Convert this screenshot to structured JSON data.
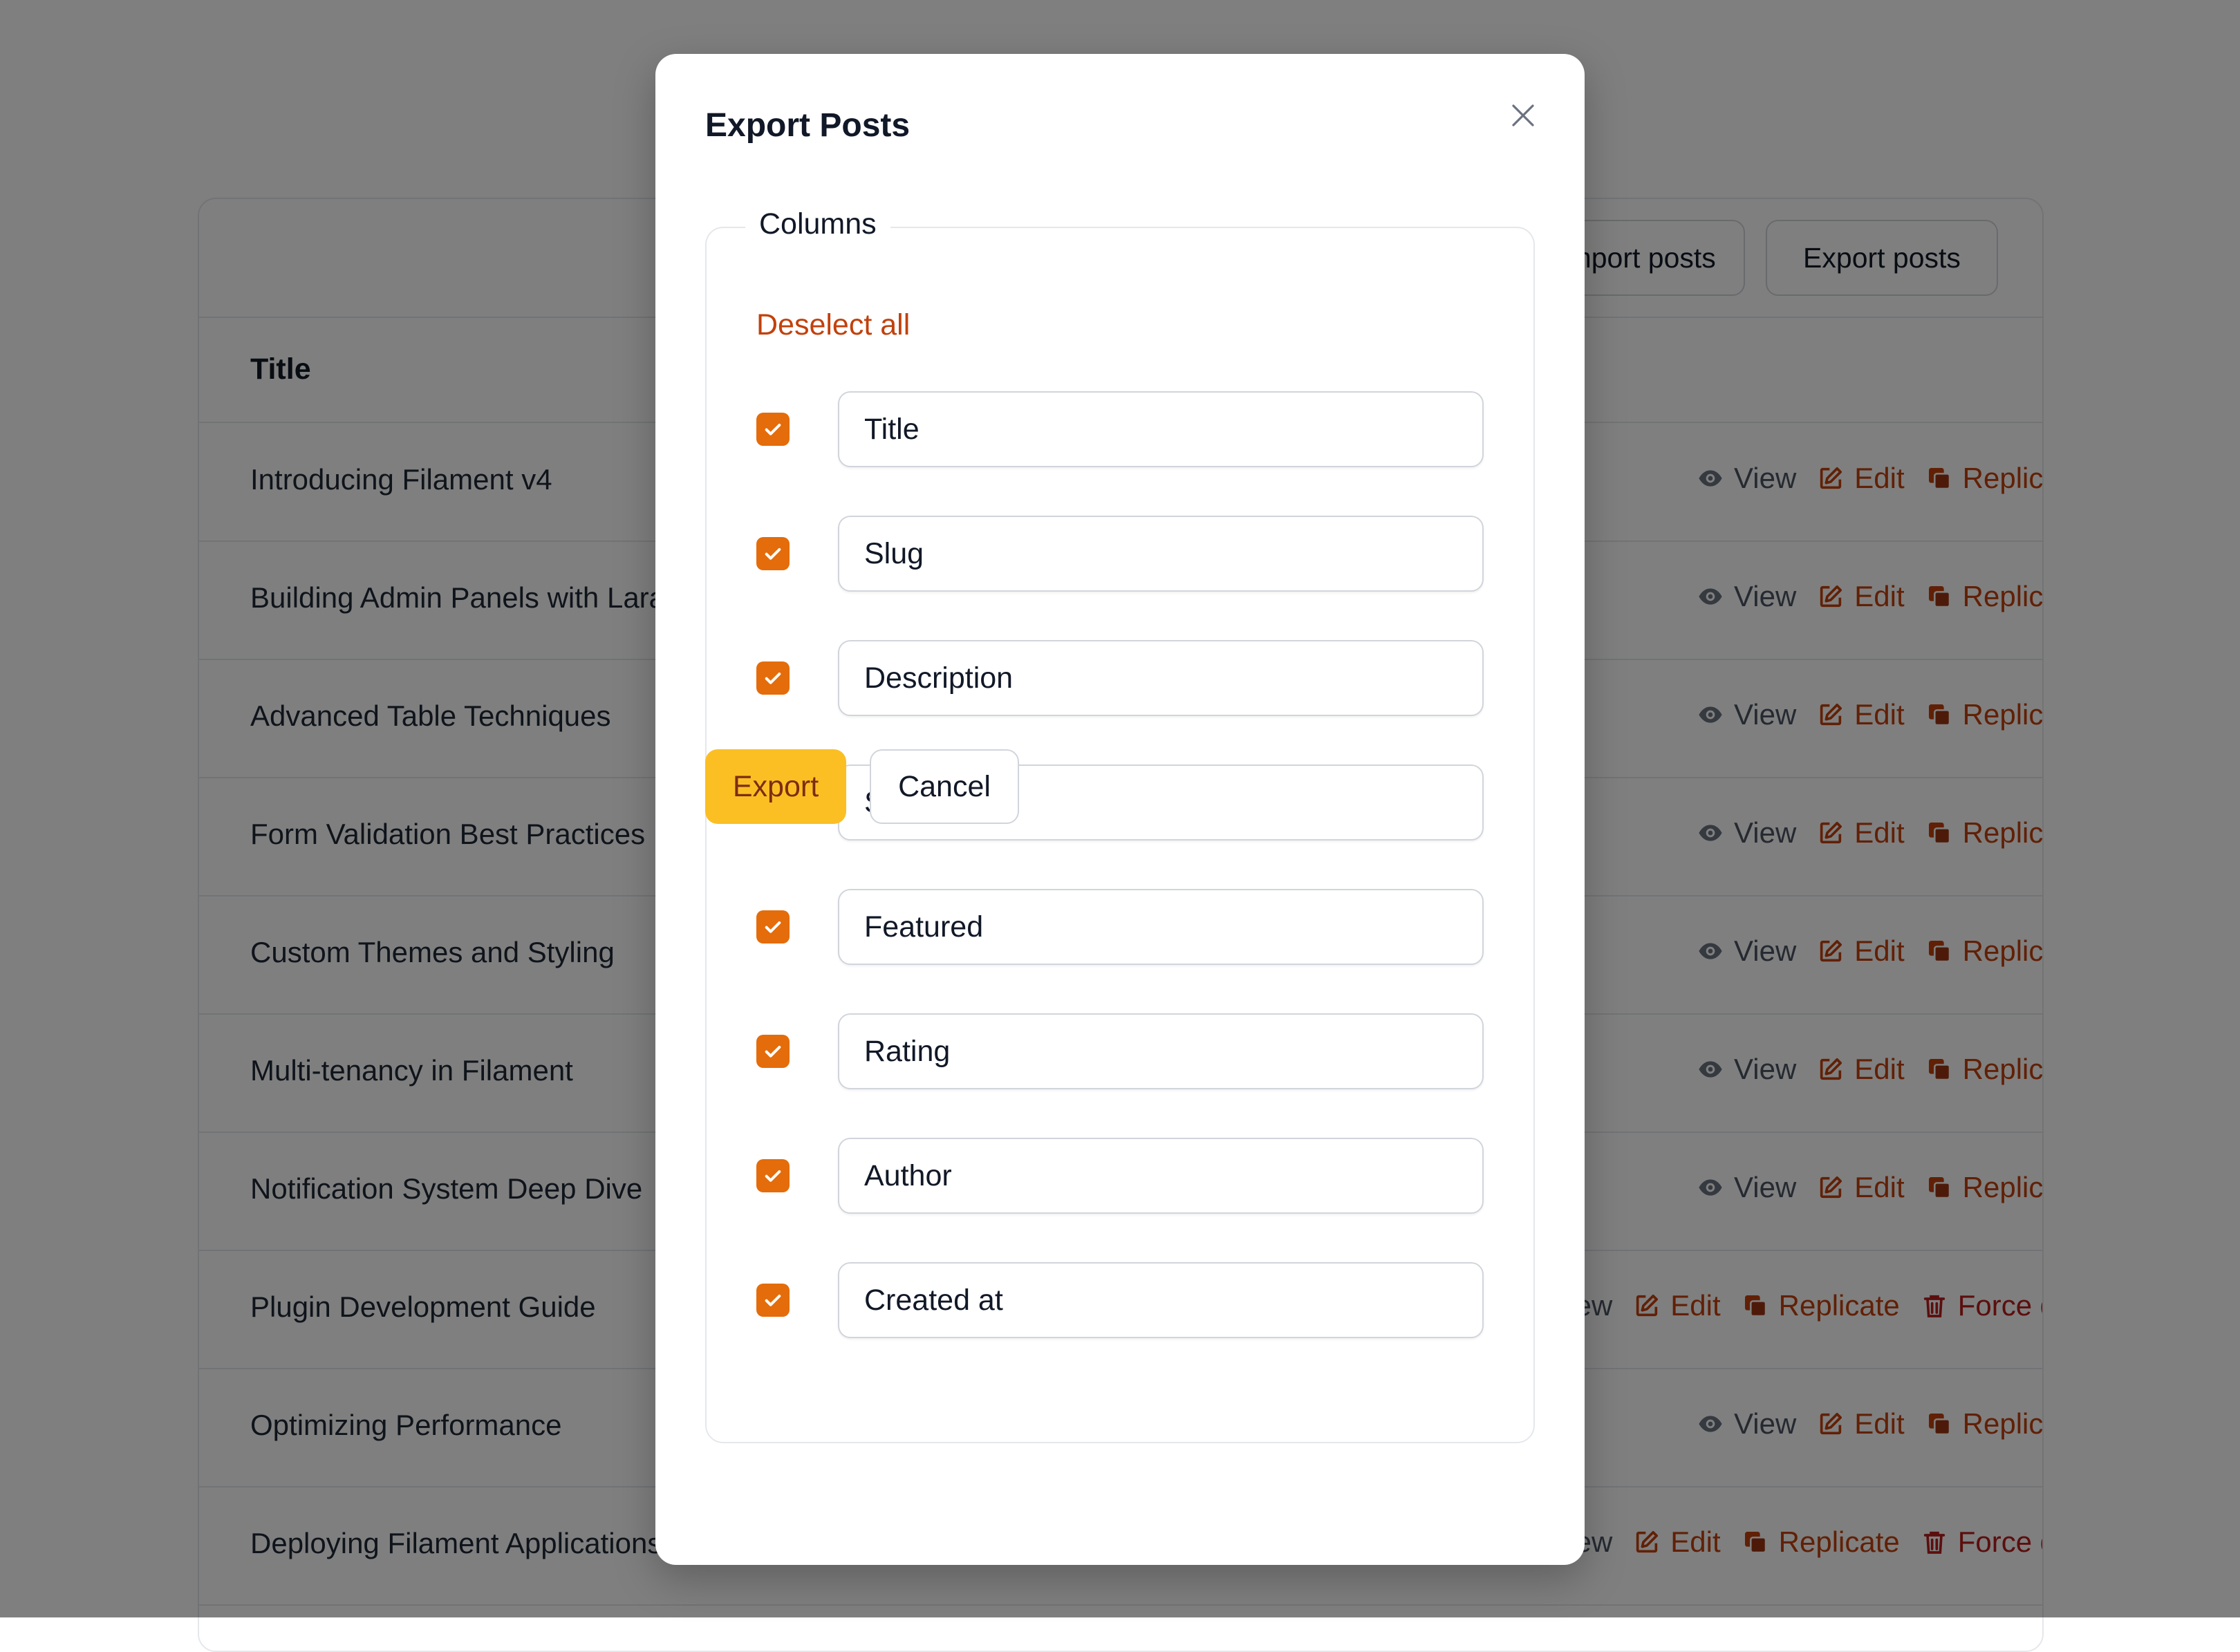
{
  "toolbar": {
    "import_label": "Import posts",
    "export_label": "Export posts"
  },
  "table": {
    "header_title": "Title",
    "rows": [
      {
        "title": "Introducing Filament v4",
        "variant": "a"
      },
      {
        "title": "Building Admin Panels with Laravel",
        "variant": "a"
      },
      {
        "title": "Advanced Table Techniques",
        "variant": "a"
      },
      {
        "title": "Form Validation Best Practices",
        "variant": "a"
      },
      {
        "title": "Custom Themes and Styling",
        "variant": "a"
      },
      {
        "title": "Multi-tenancy in Filament",
        "variant": "a"
      },
      {
        "title": "Notification System Deep Dive",
        "variant": "a"
      },
      {
        "title": "Plugin Development Guide",
        "variant": "b"
      },
      {
        "title": "Optimizing Performance",
        "variant": "a"
      },
      {
        "title": "Deploying Filament Applications",
        "variant": "b"
      }
    ],
    "actions": {
      "view": "View",
      "edit": "Edit",
      "replicate": "Replicate",
      "force_delete": "Force delete"
    }
  },
  "modal": {
    "title": "Export Posts",
    "close_icon": "x-mark-icon",
    "columns_legend": "Columns",
    "deselect_all": "Deselect all",
    "columns": [
      {
        "label": "Title",
        "checked": true
      },
      {
        "label": "Slug",
        "checked": true
      },
      {
        "label": "Description",
        "checked": true
      },
      {
        "label": "Status",
        "checked": true
      },
      {
        "label": "Featured",
        "checked": true
      },
      {
        "label": "Rating",
        "checked": true
      },
      {
        "label": "Author",
        "checked": true
      },
      {
        "label": "Created at",
        "checked": true
      }
    ],
    "export_label": "Export",
    "cancel_label": "Cancel"
  },
  "colors": {
    "primary": "#f59e0b",
    "checkbox": "#e46c0a",
    "link": "#c2410c",
    "danger": "#b91c1c"
  }
}
